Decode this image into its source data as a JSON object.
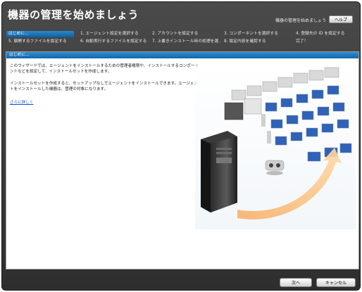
{
  "window": {
    "title": "機器の管理を始めましょう",
    "help_label": "機器の管理を始めましょう",
    "help_button": "ヘルプ"
  },
  "steps": [
    {
      "label": "はじめに...",
      "active": true
    },
    {
      "label": "1. エージェント設定を選択する",
      "active": false
    },
    {
      "label": "2. アカウントを設定する",
      "active": false
    },
    {
      "label": "3. コンポーネントを選択する",
      "active": false
    },
    {
      "label": "4. 登録先の ID を設定する",
      "active": false
    },
    {
      "label": "5. 展開するファイルを設定する",
      "active": false
    },
    {
      "label": "6. 自動実行するファイルを設定する",
      "active": false
    },
    {
      "label": "7. 上書きインストール時の処理を選...",
      "active": false
    },
    {
      "label": "8. 設定内容を確認する",
      "active": false
    },
    {
      "label": "完了！",
      "active": false
    }
  ],
  "content": {
    "section_title": "はじめに...",
    "para1": "このウィザードでは、エージェントをインストールするための管理者権限や、インストールするコンポーネントなどを設定して、インストールセットを作成します。",
    "para2": "インストールセットを作成すると、セットアップなしでエージェントをインストールできます。エージェントをインストールした機器は、管理の対象になります。",
    "more_link": "さらに詳しく"
  },
  "footer": {
    "next_button": "次へ",
    "cancel_button": "キャンセル"
  }
}
